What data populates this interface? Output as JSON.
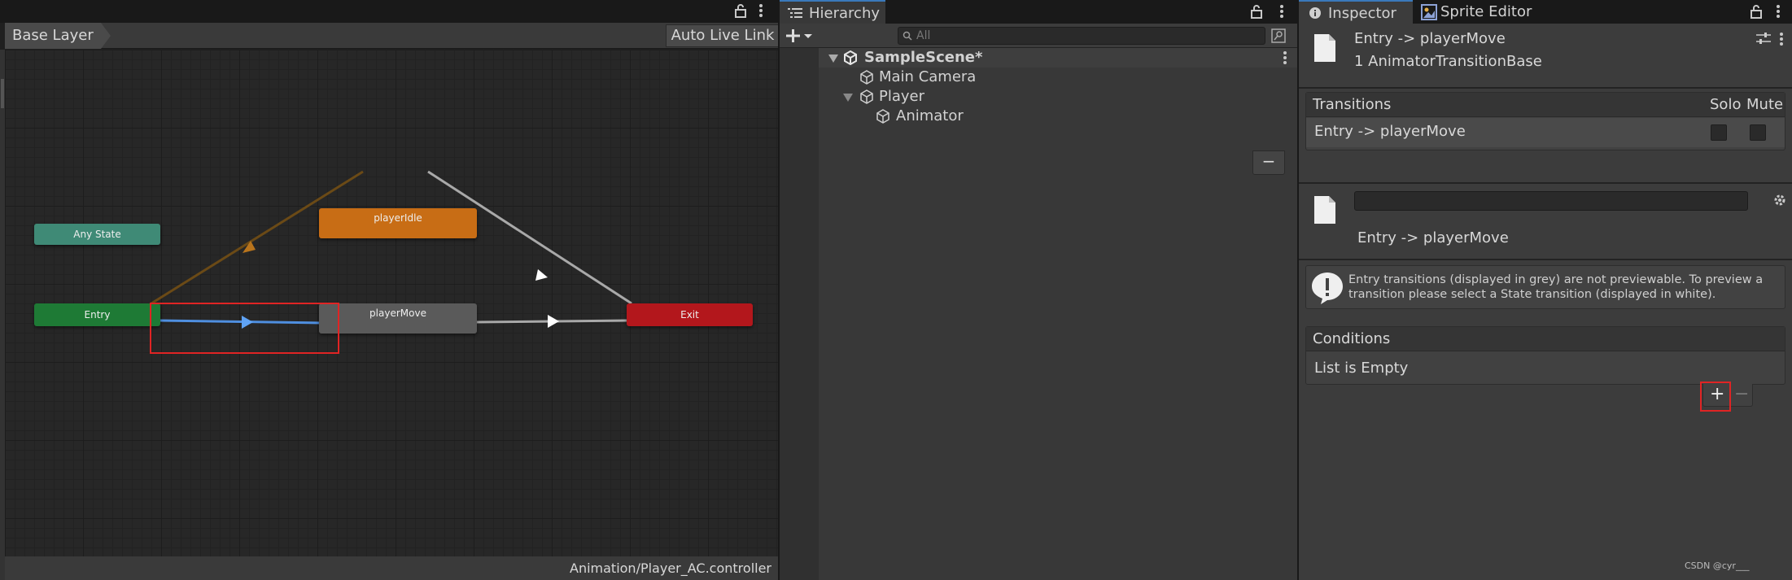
{
  "animator": {
    "breadcrumb": "Base Layer",
    "live_link_label": "Auto Live Link",
    "footer_path": "Animation/Player_AC.controller",
    "nodes": {
      "any_state": "Any State",
      "entry": "Entry",
      "idle": "playerIdle",
      "move": "playerMove",
      "exit": "Exit"
    }
  },
  "hierarchy": {
    "tab_label": "Hierarchy",
    "search_placeholder": "All",
    "scene": "SampleScene*",
    "items": [
      "Main Camera",
      "Player",
      "Animator"
    ]
  },
  "inspector": {
    "tabs": [
      "Inspector",
      "Sprite Editor"
    ],
    "title": "Entry -> playerMove",
    "subtitle": "1 AnimatorTransitionBase",
    "transitions": {
      "header": "Transitions",
      "solo_label": "Solo",
      "mute_label": "Mute",
      "rows": [
        "Entry -> playerMove"
      ]
    },
    "transition_name_field": "",
    "transition_caption": "Entry -> playerMove",
    "warning": "Entry transitions (displayed in grey) are not previewable. To preview a transition please select a State transition (displayed in white).",
    "conditions": {
      "header": "Conditions",
      "empty_text": "List is Empty"
    }
  },
  "watermark": "CSDN @cyr___",
  "colors": {
    "accent_tab": "#3a79bb",
    "highlight_box": "#e02424",
    "node_any_state": "#3f8a76",
    "node_entry": "#1e7a35",
    "node_idle": "#c86d15",
    "node_move": "#5a5a5a",
    "node_exit": "#b3171c",
    "transition_selected": "#4f8fe0"
  }
}
